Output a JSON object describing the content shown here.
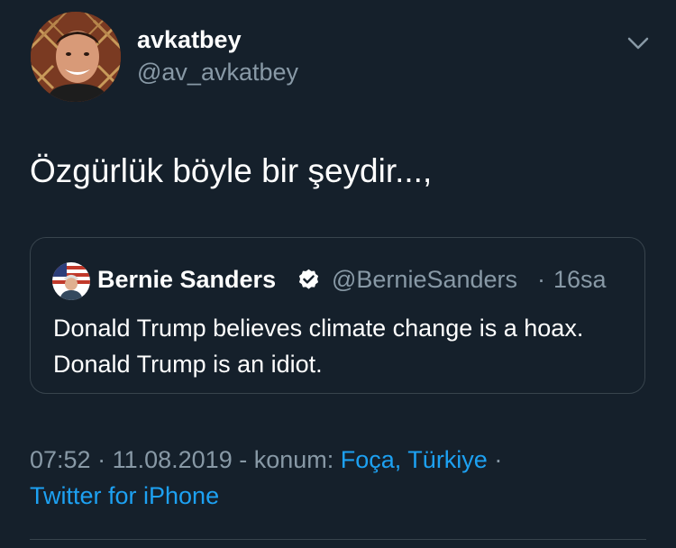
{
  "author": {
    "display_name": "avkatbey",
    "handle": "@av_avkatbey"
  },
  "tweet": {
    "text": "Özgürlük böyle bir şeydir...,"
  },
  "quoted_tweet": {
    "display_name": "Bernie Sanders",
    "handle": "@BernieSanders",
    "separator": "·",
    "time": "16sa",
    "text": "Donald Trump believes climate change is a hoax. Donald Trump is an idiot."
  },
  "meta": {
    "time": "07:52",
    "dot1": " · ",
    "date": "11.08.2019",
    "location_prefix": " - konum: ",
    "location": "Foça, Türkiye",
    "dot2": " ·",
    "source": "Twitter for iPhone"
  },
  "icons": {
    "menu": "chevron-down-icon",
    "verified": "verified-badge-icon"
  },
  "colors": {
    "background": "#15202b",
    "primary_text": "#ffffff",
    "secondary_text": "#8899a6",
    "link": "#1da1f2",
    "border": "#38444d"
  }
}
